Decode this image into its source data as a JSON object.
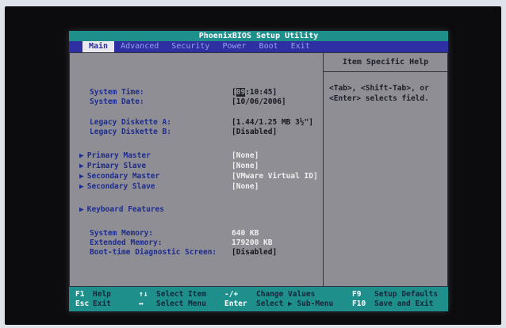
{
  "title": "PhoenixBIOS Setup Utility",
  "menu": [
    "Main",
    "Advanced",
    "Security",
    "Power",
    "Boot",
    "Exit"
  ],
  "active_menu": "Main",
  "fields": {
    "system_time": {
      "label": "System Time:",
      "cursor": "09",
      "rest": ":10:45]",
      "open": "["
    },
    "system_date": {
      "label": "System Date:",
      "value": "[10/06/2006]"
    },
    "diskette_a": {
      "label": "Legacy Diskette A:",
      "value": "[1.44/1.25 MB  3½\"]"
    },
    "diskette_b": {
      "label": "Legacy Diskette B:",
      "value": "[Disabled]"
    },
    "primary_master": {
      "label": "Primary Master",
      "value": "[None]"
    },
    "primary_slave": {
      "label": "Primary Slave",
      "value": "[None]"
    },
    "secondary_master": {
      "label": "Secondary Master",
      "value": "[VMware Virtual ID]"
    },
    "secondary_slave": {
      "label": "Secondary Slave",
      "value": "[None]"
    },
    "keyboard_features": {
      "label": "Keyboard Features"
    },
    "system_memory": {
      "label": "System Memory:",
      "value": "640 KB"
    },
    "extended_memory": {
      "label": "Extended Memory:",
      "value": "179200 KB"
    },
    "boot_diag": {
      "label": "Boot-time Diagnostic Screen:",
      "value": "[Disabled]"
    }
  },
  "submenu_arrow": "▶",
  "help": {
    "title": "Item Specific Help",
    "line1": "<Tab>, <Shift-Tab>, or",
    "line2": "<Enter> selects field."
  },
  "footer": {
    "f1_key": "F1",
    "f1_desc": "Help",
    "ud_key": "↑↓",
    "ud_desc": "Select Item",
    "pm_key": "-/+",
    "pm_desc": "Change Values",
    "f9_key": "F9",
    "f9_desc": "Setup Defaults",
    "esc_key": "Esc",
    "esc_desc": "Exit",
    "lr_key": "↔",
    "lr_desc": "Select Menu",
    "enter_key": "Enter",
    "enter_desc": "Select ▶ Sub-Menu",
    "f10_key": "F10",
    "f10_desc": "Save and Exit"
  }
}
